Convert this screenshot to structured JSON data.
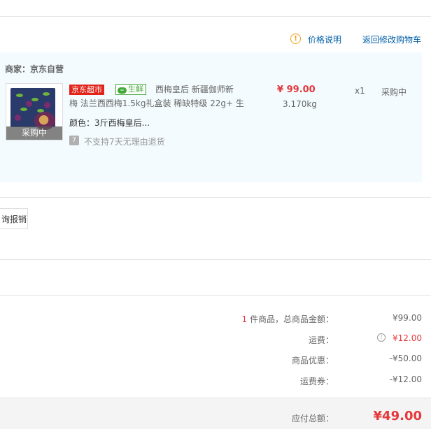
{
  "header": {
    "price_help_link": "价格说明",
    "back_to_cart_link": "返回修改购物车"
  },
  "shop": {
    "seller_label": "商家：京东自营"
  },
  "item": {
    "thumb_overlay": "采购中",
    "tag_jd": "京东超市",
    "tag_fresh": "生鲜",
    "tag_fresh_mark": "∞",
    "title_line1": "西梅皇后 新疆伽师新",
    "title_line2": "梅 法兰西西梅1.5kg礼盒装 稀缺特级 22g+ 生",
    "price": "¥ 99.00",
    "weight": "3.170kg",
    "quantity": "x1",
    "status": "采购中",
    "color_line": "颜色：3斤西梅皇后...",
    "return_icon": "7",
    "return_text": "不支持7天无理由退货"
  },
  "invoice": {
    "button_label": "询报销"
  },
  "summary": {
    "count": "1",
    "goods_total_label": " 件商品，总商品金额：",
    "goods_total_value": "¥99.00",
    "shipping_label": "运费：",
    "shipping_value": "¥12.00",
    "discount_label": "商品优惠：",
    "discount_value": "-¥50.00",
    "shipping_coupon_label": "运费券：",
    "shipping_coupon_value": "-¥12.00",
    "total_label": "应付总额：",
    "total_value": "¥49.00"
  },
  "colors": {
    "accent_red": "#e4393c",
    "link_blue": "#005ea7",
    "fresh_green": "#40a835",
    "panel_bg": "#f3fbfe"
  }
}
